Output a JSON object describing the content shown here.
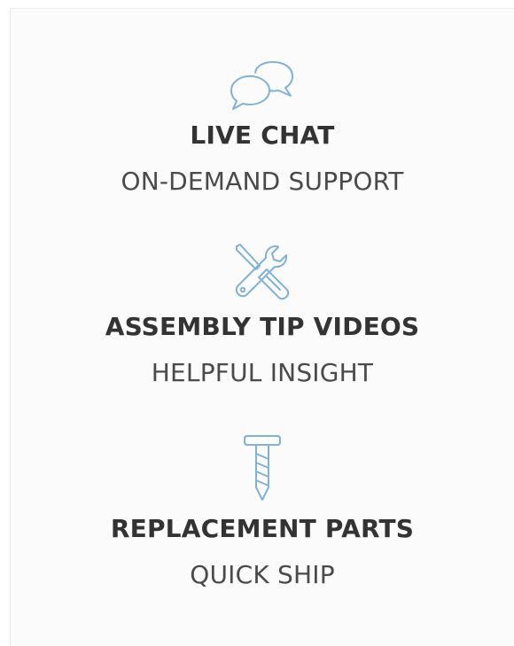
{
  "features": [
    {
      "icon": "chat-bubbles-icon",
      "title": "LIVE CHAT",
      "subtitle": "ON-DEMAND SUPPORT"
    },
    {
      "icon": "screwdriver-wrench-icon",
      "title": "ASSEMBLY TIP VIDEOS",
      "subtitle": "HELPFUL INSIGHT"
    },
    {
      "icon": "screw-icon",
      "title": "REPLACEMENT PARTS",
      "subtitle": "QUICK SHIP"
    }
  ],
  "colors": {
    "icon_stroke": "#7fb2d9",
    "title_text": "#333333",
    "subtitle_text": "#4a4a4a"
  }
}
